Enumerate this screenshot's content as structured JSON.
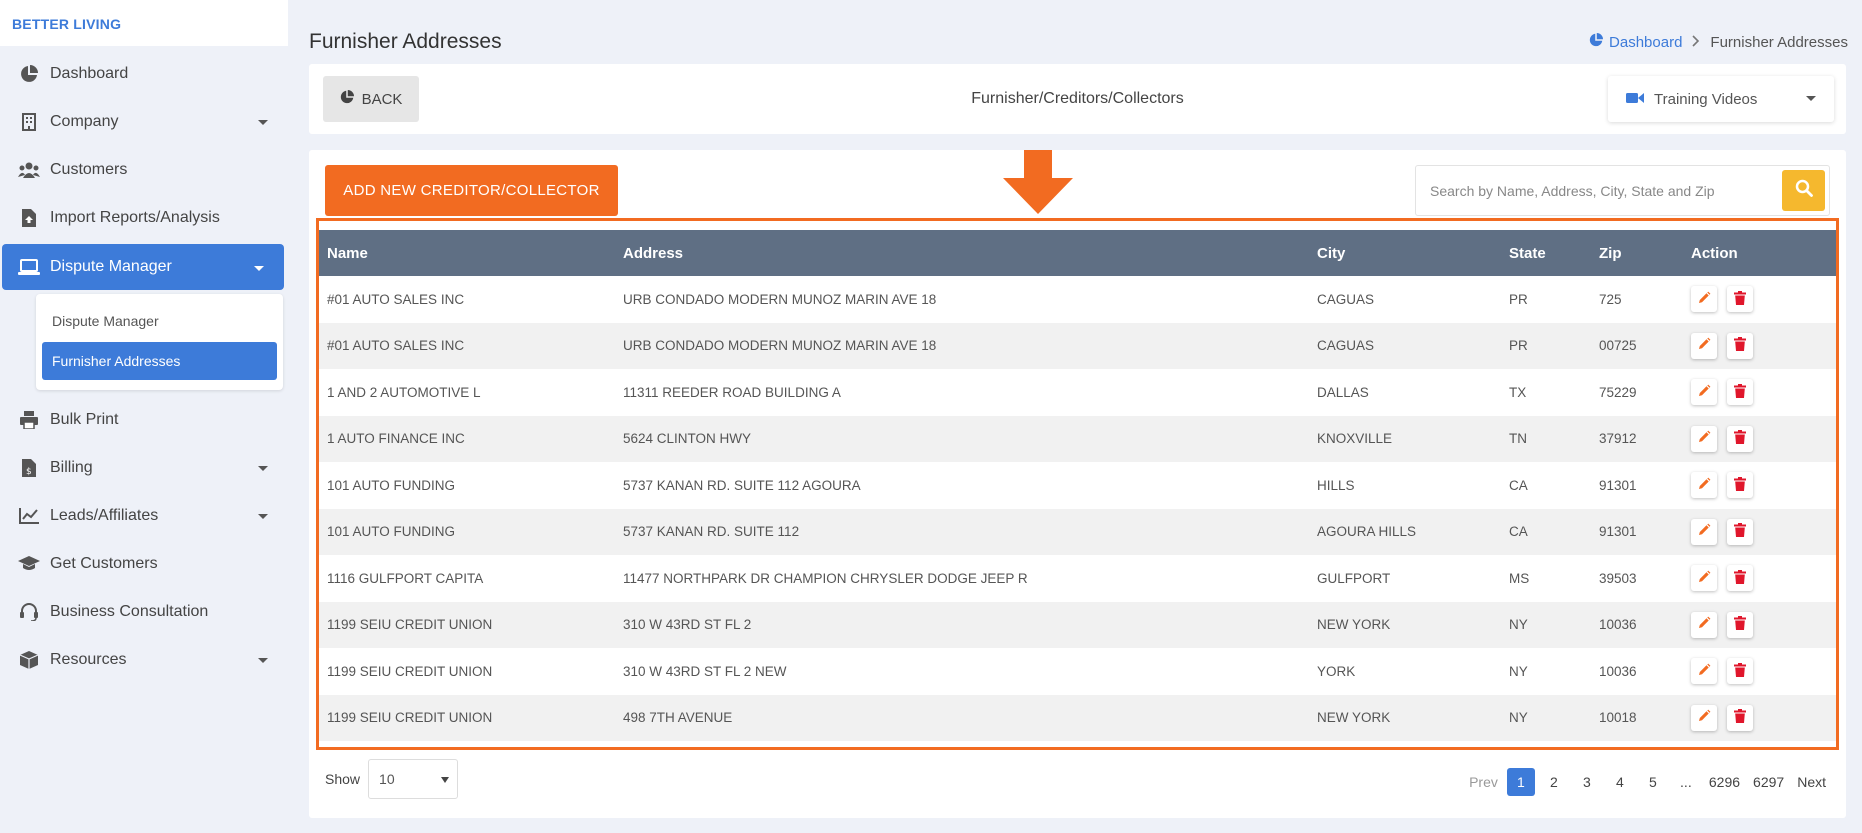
{
  "brand": "BETTER LIVING",
  "sidebar": {
    "items": [
      {
        "label": "Dashboard"
      },
      {
        "label": "Company"
      },
      {
        "label": "Customers"
      },
      {
        "label": "Import Reports/Analysis"
      },
      {
        "label": "Dispute Manager"
      },
      {
        "label": "Bulk Print"
      },
      {
        "label": "Billing"
      },
      {
        "label": "Leads/Affiliates"
      },
      {
        "label": "Get Customers"
      },
      {
        "label": "Business Consultation"
      },
      {
        "label": "Resources"
      }
    ],
    "subitems": [
      {
        "label": "Dispute Manager"
      },
      {
        "label": "Furnisher Addresses"
      }
    ]
  },
  "header": {
    "title": "Furnisher Addresses",
    "breadcrumb": {
      "home": "Dashboard",
      "current": "Furnisher Addresses"
    }
  },
  "topbar": {
    "back_label": "BACK",
    "title": "Furnisher/Creditors/Collectors",
    "training_label": "Training Videos"
  },
  "main": {
    "add_label": "ADD NEW CREDITOR/COLLECTOR",
    "search_placeholder": "Search by Name, Address, City, State and Zip",
    "columns": [
      "Name",
      "Address",
      "City",
      "State",
      "Zip",
      "Action"
    ],
    "rows": [
      [
        "#01 AUTO SALES INC",
        "URB CONDADO MODERN MUNOZ MARIN AVE 18",
        "CAGUAS",
        "PR",
        "725"
      ],
      [
        "#01 AUTO SALES INC",
        "URB CONDADO MODERN MUNOZ MARIN AVE 18",
        "CAGUAS",
        "PR",
        "00725"
      ],
      [
        "1 AND 2 AUTOMOTIVE L",
        "11311 REEDER ROAD BUILDING A",
        "DALLAS",
        "TX",
        "75229"
      ],
      [
        "1 AUTO FINANCE INC",
        "5624 CLINTON HWY",
        "KNOXVILLE",
        "TN",
        "37912"
      ],
      [
        "101 AUTO FUNDING",
        "5737 KANAN RD. SUITE 112 AGOURA",
        "HILLS",
        "CA",
        "91301"
      ],
      [
        "101 AUTO FUNDING",
        "5737 KANAN RD. SUITE 112",
        "AGOURA HILLS",
        "CA",
        "91301"
      ],
      [
        "1116 GULFPORT CAPITA",
        "11477 NORTHPARK DR CHAMPION CHRYSLER DODGE JEEP R",
        "GULFPORT",
        "MS",
        "39503"
      ],
      [
        "1199 SEIU CREDIT UNION",
        "310 W 43RD ST FL 2",
        "NEW YORK",
        "NY",
        "10036"
      ],
      [
        "1199 SEIU CREDIT UNION",
        "310 W 43RD ST FL 2 NEW",
        "YORK",
        "NY",
        "10036"
      ],
      [
        "1199 SEIU CREDIT UNION",
        "498 7TH AVENUE",
        "NEW YORK",
        "NY",
        "10018"
      ]
    ],
    "show_label": "Show",
    "page_size": "10",
    "pagination": {
      "prev": "Prev",
      "pages": [
        "1",
        "2",
        "3",
        "4",
        "5",
        "...",
        "6296",
        "6297"
      ],
      "next": "Next"
    }
  },
  "colors": {
    "accent": "#3d7bd9",
    "orange": "#f26b21",
    "header_row": "#5f6f84",
    "search_btn": "#f5b82e",
    "delete": "#e0162b"
  }
}
